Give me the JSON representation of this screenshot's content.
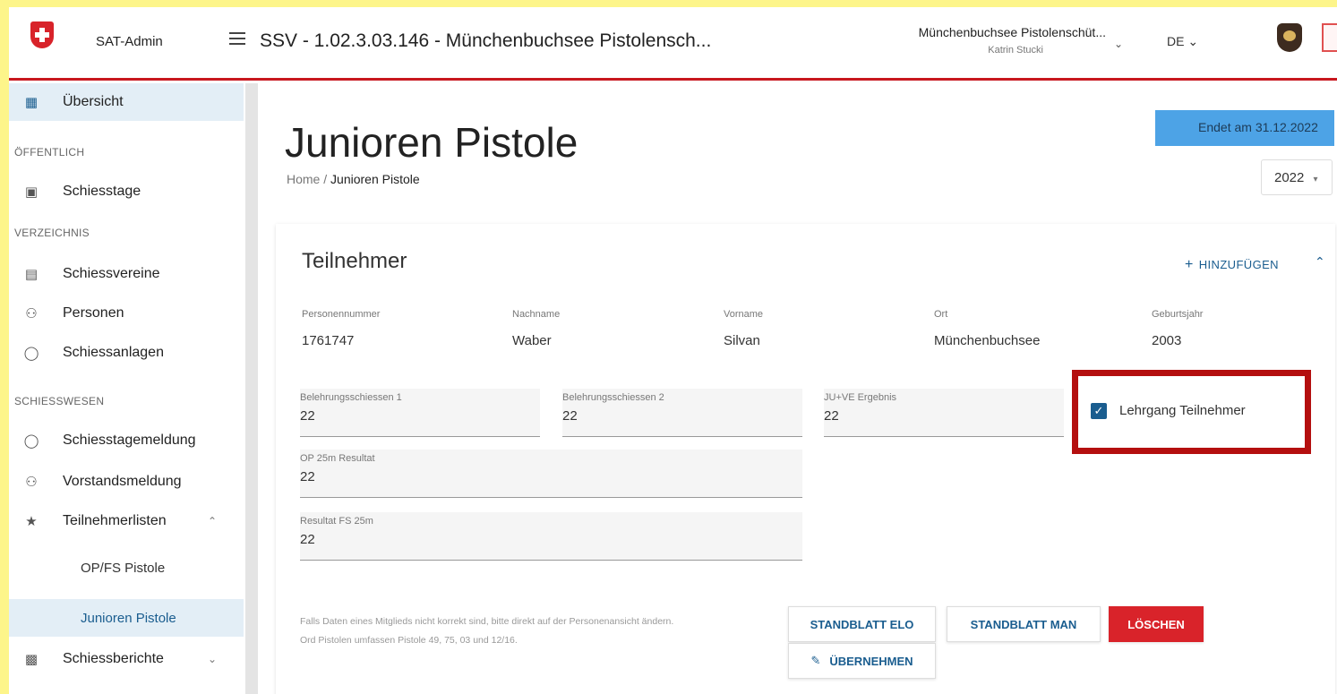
{
  "header": {
    "app_name": "SAT-Admin",
    "title": "SSV - 1.02.3.03.146 - Münchenbuchsee Pistolensch...",
    "org_name": "Münchenbuchsee Pistolenschüt...",
    "user_name": "Katrin Stucki",
    "language": "DE"
  },
  "sidebar": {
    "overview": "Übersicht",
    "sections": [
      "ÖFFENTLICH",
      "VERZEICHNIS",
      "SCHIESSWESEN"
    ],
    "items": [
      {
        "label": "Schiesstage",
        "icon": "calendar-icon"
      },
      {
        "label": "Schiessvereine",
        "icon": "building-icon"
      },
      {
        "label": "Personen",
        "icon": "people-icon"
      },
      {
        "label": "Schiessanlagen",
        "icon": "circle-icon"
      },
      {
        "label": "Schiesstagemeldung",
        "icon": "circle-icon"
      },
      {
        "label": "Vorstandsmeldung",
        "icon": "people-icon"
      },
      {
        "label": "Teilnehmerlisten",
        "icon": "star-icon"
      },
      {
        "label": "Schiessberichte",
        "icon": "document-icon"
      }
    ],
    "subitems": [
      "OP/FS Pistole",
      "Junioren Pistole"
    ]
  },
  "main": {
    "title": "Junioren Pistole",
    "breadcrumb_home": "Home",
    "breadcrumb_sep": "/",
    "breadcrumb_current": "Junioren Pistole",
    "status": "Endet am 31.12.2022",
    "year": "2022"
  },
  "card": {
    "title": "Teilnehmer",
    "add_label": "HINZUFÜGEN",
    "columns": [
      {
        "label": "Personennummer",
        "value": "1761747"
      },
      {
        "label": "Nachname",
        "value": "Waber"
      },
      {
        "label": "Vorname",
        "value": "Silvan"
      },
      {
        "label": "Ort",
        "value": "Münchenbuchsee"
      },
      {
        "label": "Geburtsjahr",
        "value": "2003"
      }
    ],
    "fields": [
      {
        "label": "Belehrungsschiessen 1",
        "value": "22"
      },
      {
        "label": "Belehrungsschiessen 2",
        "value": "22"
      },
      {
        "label": "JU+VE Ergebnis",
        "value": "22"
      },
      {
        "label": "OP 25m Resultat",
        "value": "22"
      },
      {
        "label": "Resultat FS 25m",
        "value": "22"
      }
    ],
    "checkbox_label": "Lehrgang Teilnehmer",
    "checkbox_checked": true,
    "footnote": "Falls Daten eines Mitglieds nicht korrekt sind, bitte direkt auf der Personenansicht ändern. Ord Pistolen umfassen Pistole 49, 75, 03 und 12/16.",
    "buttons": {
      "standblatt_elo": "STANDBLATT ELO",
      "standblatt_man": "STANDBLATT MAN",
      "loeschen": "LÖSCHEN",
      "uebernehmen": "ÜBERNEHMEN"
    }
  }
}
